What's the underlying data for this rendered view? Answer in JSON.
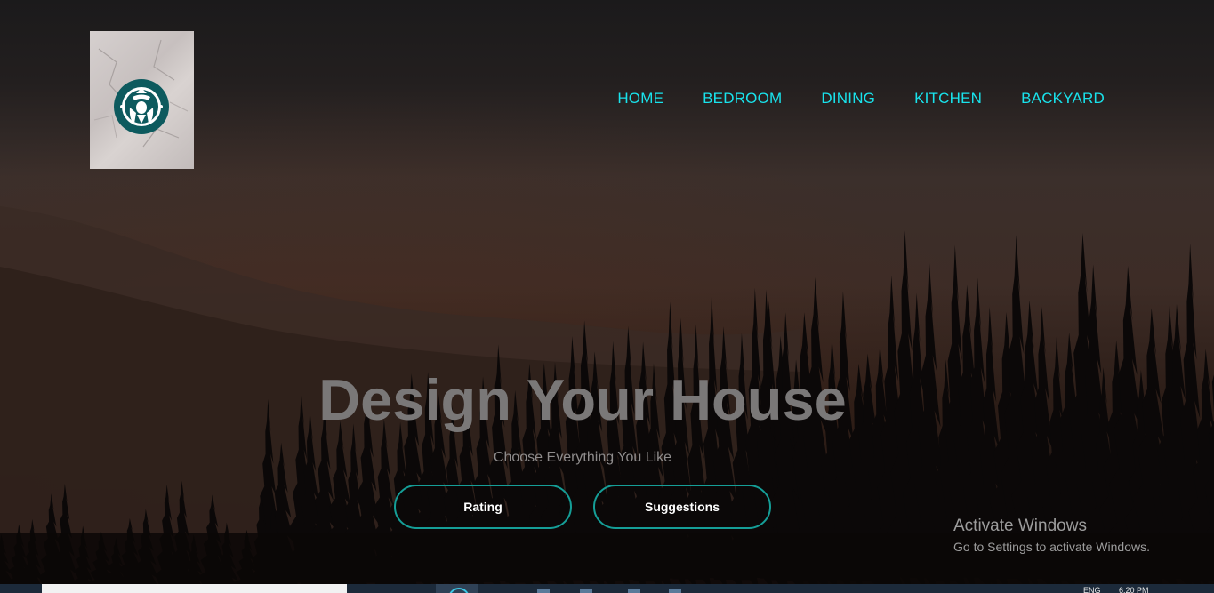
{
  "logo": {
    "icon": "starbucks-siren-logo",
    "colors": {
      "ring": "#0d5a5e",
      "face": "#ffffff"
    }
  },
  "nav": {
    "items": [
      {
        "label": "HOME"
      },
      {
        "label": "BEDROOM"
      },
      {
        "label": "DINING"
      },
      {
        "label": "KITCHEN"
      },
      {
        "label": "BACKYARD"
      }
    ],
    "color": "#19e3ec"
  },
  "hero": {
    "title": "Design Your House",
    "subtitle": "Choose Everything You Like",
    "buttons": {
      "rating": "Rating",
      "suggestions": "Suggestions"
    },
    "button_border_color": "#159e97"
  },
  "windows_watermark": {
    "title": "Activate Windows",
    "subtitle": "Go to Settings to activate Windows."
  },
  "taskbar": {
    "language": "ENG",
    "time": "6:20 PM"
  }
}
